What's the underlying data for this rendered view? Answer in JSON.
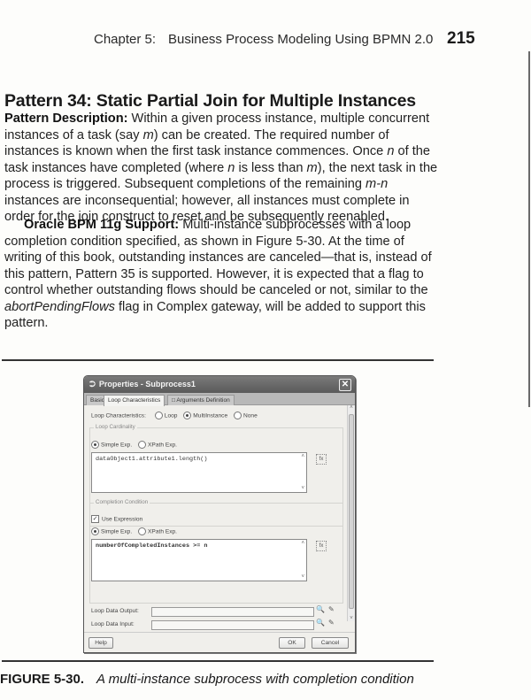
{
  "page": {
    "running_head": {
      "chapter": "Chapter 5:",
      "title": "Business Process Modeling Using BPMN 2.0",
      "page_number": "215"
    },
    "section_title": "Pattern 34: Static Partial Join for Multiple Instances",
    "paragraph1": {
      "lead": "Pattern Description:",
      "segments": [
        " Within a given process instance, multiple concurrent instances of a task (say ",
        "m",
        ") can be created. The required number of instances is known when the first task instance commences. Once ",
        "n",
        " of the task instances have completed (where ",
        "n",
        " is less than ",
        "m",
        "), the next task in the process is triggered. Subsequent completions of the remaining ",
        "m-n",
        " instances are inconsequential; however, all instances must complete in order for the join construct to reset and be subsequently reenabled."
      ]
    },
    "paragraph2": {
      "lead": "Oracle BPM 11g Support:",
      "text_a": " Multi-instance subprocesses with a loop completion condition specified, as shown in Figure 5-30. At the time of writing of this book, outstanding instances are canceled—that is, instead of this pattern, Pattern 35 is supported. However, it is expected that a flag to control whether outstanding flows should be canceled or not, similar to the ",
      "italic": "abortPendingFlows",
      "text_b": " flag in Complex gateway, will be added to support this pattern."
    },
    "figure_caption": {
      "label": "FIGURE 5-30.",
      "text": "A multi-instance subprocess with completion condition"
    }
  },
  "dialog": {
    "title": "Properties - Subprocess1",
    "title_icon": "⮊",
    "close_glyph": "✕",
    "tabs": [
      {
        "label": "Basic",
        "active": false
      },
      {
        "label": "Loop Characteristics",
        "active": true
      },
      {
        "label": "□ Arguments Definition",
        "active": false
      }
    ],
    "loop_characteristics": {
      "label": "Loop Characteristics:",
      "options": [
        "Loop",
        "MultiInstance",
        "None"
      ],
      "selected": "MultiInstance"
    },
    "loop_cardinality": {
      "group_label": "Loop Cardinality",
      "options": [
        "Simple Exp.",
        "XPath Exp."
      ],
      "selected": "Simple Exp.",
      "expression": "dataObject1.attribute1.length()"
    },
    "completion_condition": {
      "group_label": "Completion Condition",
      "use_expression_label": "Use Expression",
      "use_expression_checked": true,
      "check_glyph": "✓",
      "options": [
        "Simple Exp.",
        "XPath Exp."
      ],
      "selected": "Simple Exp.",
      "expression": "numberOfCompletedInstances >= n"
    },
    "loop_data_output": {
      "label": "Loop Data Output:",
      "value": ""
    },
    "loop_data_input": {
      "label": "Loop Data Input:",
      "value": ""
    },
    "icons": {
      "search": "🔍",
      "eraser": "✎",
      "expr": "fx",
      "up": "˄",
      "down": "˅"
    },
    "buttons": {
      "help": "Help",
      "ok": "OK",
      "cancel": "Cancel"
    }
  }
}
